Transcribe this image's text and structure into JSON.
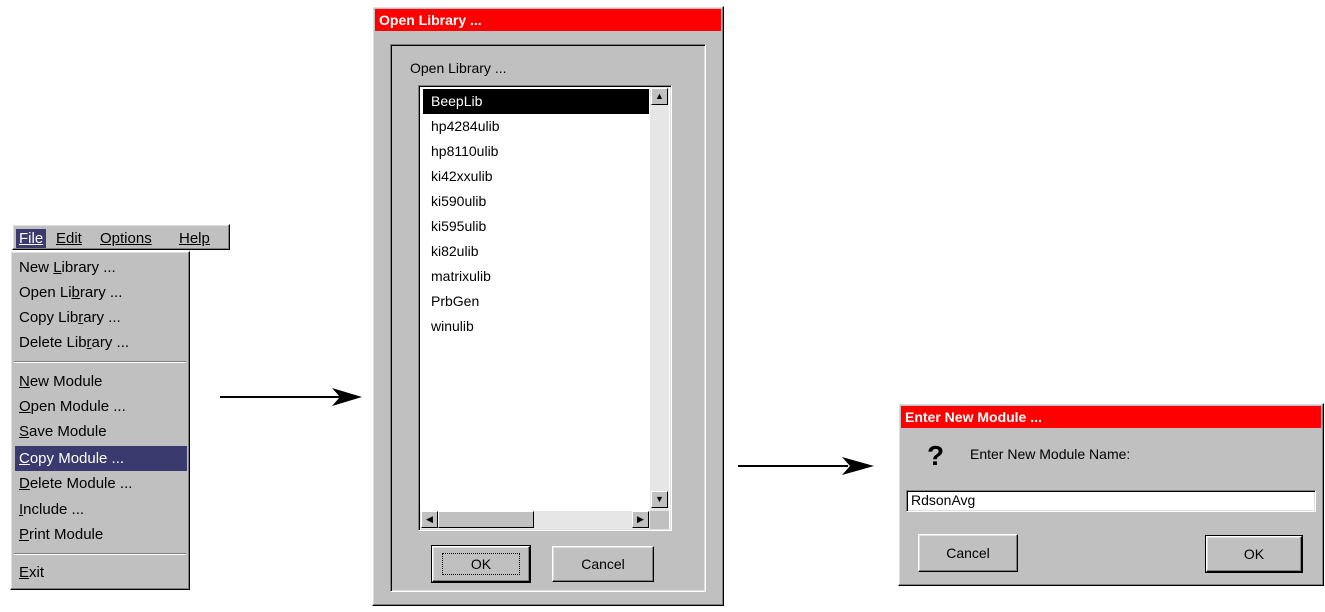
{
  "menu": {
    "menubar": [
      {
        "label": "File",
        "hotkey_index": 0
      },
      {
        "label": "Edit",
        "hotkey_index": 0
      },
      {
        "label": "Options",
        "hotkey_index": 0
      },
      {
        "label": "Help",
        "hotkey_index": 0
      }
    ],
    "items": [
      {
        "pre": "New ",
        "u": "L",
        "post": "ibrary ..."
      },
      {
        "pre": "Open Li",
        "u": "b",
        "post": "rary ..."
      },
      {
        "pre": "Copy Lib",
        "u": "r",
        "post": "ary ..."
      },
      {
        "pre": "Delete Lib",
        "u": "r",
        "post": "ary ..."
      },
      {
        "pre": "",
        "u": "N",
        "post": "ew Module"
      },
      {
        "pre": "",
        "u": "O",
        "post": "pen Module ..."
      },
      {
        "pre": "",
        "u": "S",
        "post": "ave Module"
      },
      {
        "pre": "",
        "u": "C",
        "post": "opy Module ..."
      },
      {
        "pre": "",
        "u": "D",
        "post": "elete Module ..."
      },
      {
        "pre": "",
        "u": "I",
        "post": "nclude ..."
      },
      {
        "pre": "",
        "u": "P",
        "post": "rint Module"
      },
      {
        "pre": "",
        "u": "E",
        "post": "xit"
      }
    ],
    "selected_item": "Copy Module ..."
  },
  "open_library": {
    "title": "Open Library ...",
    "label": "Open Library ...",
    "libraries": [
      "BeepLib",
      "hp4284ulib",
      "hp8110ulib",
      "ki42xxulib",
      "ki590ulib",
      "ki595ulib",
      "ki82ulib",
      "matrixulib",
      "PrbGen",
      "winulib"
    ],
    "selected": "BeepLib",
    "ok_label": "OK",
    "cancel_label": "Cancel"
  },
  "enter_module": {
    "title": "Enter New Module ...",
    "icon": "question-icon",
    "prompt": "Enter New Module Name:",
    "value": "RdsonAvg",
    "cancel_label": "Cancel",
    "ok_label": "OK"
  },
  "colors": {
    "title_bar": "#ff0000",
    "dialog_face": "#c0c0c0",
    "menu_highlight": "#3a3a6e"
  }
}
